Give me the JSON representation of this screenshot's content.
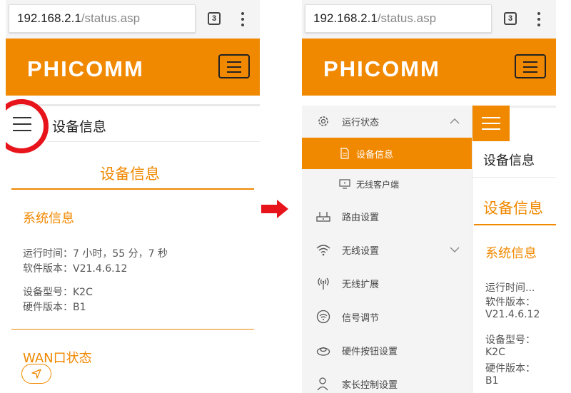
{
  "browser": {
    "url_host": "192.168.2.1",
    "url_path": "/status.asp",
    "tab_count": "3"
  },
  "brand": {
    "logo_text": "PHICOMM"
  },
  "left": {
    "topbar_title": "设备信息",
    "page_title": "设备信息",
    "system_section": "系统信息",
    "uptime": "运行时间：7 小时，55 分，7 秒",
    "software": "软件版本：V21.4.6.12",
    "model": "设备型号：K2C",
    "hardware": "硬件版本：B1",
    "wan_section": "WAN口状态"
  },
  "sidebar": {
    "items": [
      {
        "label": "运行状态",
        "icon": "gear-icon"
      },
      {
        "label": "设备信息",
        "icon": "document-icon"
      },
      {
        "label": "无线客户端",
        "icon": "monitor-icon"
      },
      {
        "label": "路由设置",
        "icon": "router-icon"
      },
      {
        "label": "无线设置",
        "icon": "wifi-icon"
      },
      {
        "label": "无线扩展",
        "icon": "antenna-icon"
      },
      {
        "label": "信号调节",
        "icon": "signal-icon"
      },
      {
        "label": "硬件按钮设置",
        "icon": "button-icon"
      },
      {
        "label": "家长控制设置",
        "icon": "person-icon"
      }
    ]
  },
  "right": {
    "topbar_title": "设备信息",
    "page_title": "设备信息",
    "system_section": "系统信息",
    "lines": [
      "运行时间...",
      "软件版本：",
      "V21.4.6.12",
      "设备型号：",
      "K2C",
      "硬件版本：",
      "B1"
    ]
  },
  "colors": {
    "accent": "#f08800",
    "highlight_circle": "#e8141b",
    "arrow": "#e8141b"
  }
}
